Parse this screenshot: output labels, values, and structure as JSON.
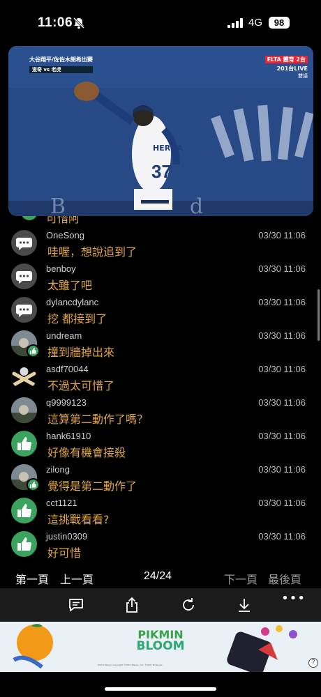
{
  "status_bar": {
    "time": "11:06",
    "network": "4G",
    "battery": "98"
  },
  "video": {
    "banner_title": "大谷翔平/佐佐木朗希出賽",
    "banner_sub": "道奇 vs 老虎",
    "channel_logo": "ELTA 體育 2台",
    "channel": "201台LIVE",
    "audio": "雙語",
    "player_name": "HERNA",
    "player_number": "37",
    "accent_color": "#274a86"
  },
  "partial_comment": {
    "text": "可惜阿"
  },
  "comments": [
    {
      "user": "OneSong",
      "time": "03/30 11:06",
      "text": "哇喔，想說追到了",
      "avatar": "speech-bubble-icon"
    },
    {
      "user": "benboy",
      "time": "03/30 11:06",
      "text": "太雖了吧",
      "avatar": "speech-bubble-icon"
    },
    {
      "user": "dylancdylanc",
      "time": "03/30 11:06",
      "text": "挖 都接到了",
      "avatar": "speech-bubble-icon"
    },
    {
      "user": "undream",
      "time": "03/30 11:06",
      "text": "撞到牆掉出來",
      "avatar": "user-photo"
    },
    {
      "user": "asdf70044",
      "time": "03/30 11:06",
      "text": "不過太可惜了",
      "avatar": "crossed-arms-icon"
    },
    {
      "user": "q9999123",
      "time": "03/30 11:06",
      "text": "這算第二動作了嗎？",
      "avatar": "user-photo"
    },
    {
      "user": "hank61910",
      "time": "03/30 11:06",
      "text": "好像有機會接殺",
      "avatar": "thumbs-up-icon"
    },
    {
      "user": "zilong",
      "time": "03/30 11:06",
      "text": "覺得是第二動作了",
      "avatar": "user-photo"
    },
    {
      "user": "cct1121",
      "time": "03/30 11:06",
      "text": "這挑戰看看?",
      "avatar": "thumbs-up-icon"
    },
    {
      "user": "justin0309",
      "time": "03/30 11:06",
      "text": "好可惜",
      "avatar": "thumbs-up-icon"
    }
  ],
  "pager": {
    "first": "第一頁",
    "prev": "上一頁",
    "page": "24/24",
    "next": "下一頁",
    "last": "最後頁"
  },
  "toolbar": {
    "icons": [
      "comment-icon",
      "share-icon",
      "reload-icon",
      "download-icon",
      "more-icon"
    ],
    "more": "•••"
  },
  "ad": {
    "title_line1": "PIKMIN",
    "title_line2": "BLOOM",
    "fine_print": "Pikmin Bloom Copyright ©2021 Niantic, Inc. ©2021 Nintendo",
    "help": "?"
  },
  "colors": {
    "comment_text": "#e0a53c",
    "like_green": "#3aa35d"
  }
}
